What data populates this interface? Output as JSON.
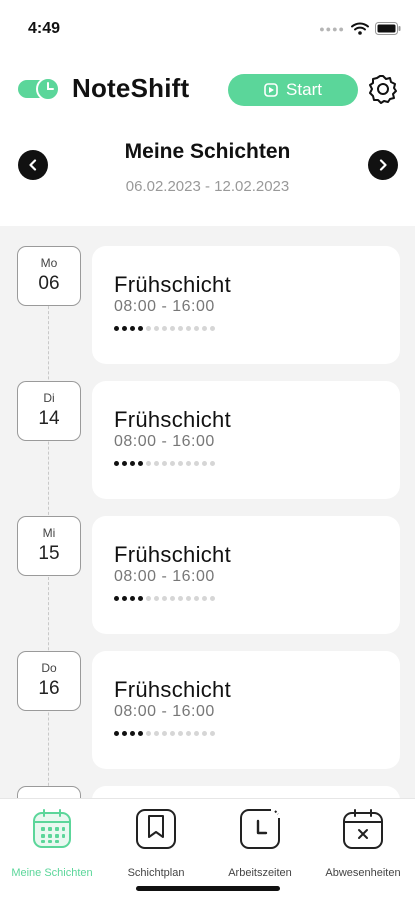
{
  "status_bar": {
    "time": "4:49",
    "icons": [
      "signal-dots-icon",
      "wifi-icon",
      "battery-icon"
    ]
  },
  "header": {
    "app_name": "NoteShift",
    "logo_icon": "toggle-clock-logo-icon",
    "start_label": "Start",
    "start_icon": "play-icon",
    "settings_icon": "gear-icon"
  },
  "week_nav": {
    "title": "Meine Schichten",
    "range": "06.02.2023 - 12.02.2023",
    "prev_icon": "chevron-left-icon",
    "next_icon": "chevron-right-icon"
  },
  "shifts": [
    {
      "day": "Mo",
      "date": "06",
      "title": "Frühschicht",
      "time": "08:00 - 16:00",
      "progress_filled": 4,
      "progress_total": 13
    },
    {
      "day": "Di",
      "date": "14",
      "title": "Frühschicht",
      "time": "08:00 - 16:00",
      "progress_filled": 4,
      "progress_total": 13
    },
    {
      "day": "Mi",
      "date": "15",
      "title": "Frühschicht",
      "time": "08:00 - 16:00",
      "progress_filled": 4,
      "progress_total": 13
    },
    {
      "day": "Do",
      "date": "16",
      "title": "Frühschicht",
      "time": "08:00 - 16:00",
      "progress_filled": 4,
      "progress_total": 13
    }
  ],
  "tabs": [
    {
      "label": "Meine Schichten",
      "icon": "calendar-grid-icon",
      "active": true
    },
    {
      "label": "Schichtplan",
      "icon": "bookmark-icon",
      "active": false
    },
    {
      "label": "Arbeitszeiten",
      "icon": "clock-icon",
      "active": false
    },
    {
      "label": "Abwesenheiten",
      "icon": "calendar-x-icon",
      "active": false
    }
  ],
  "colors": {
    "accent": "#5bd69a",
    "text": "#111111",
    "muted": "#999999",
    "list_background": "#f3f3f3"
  }
}
